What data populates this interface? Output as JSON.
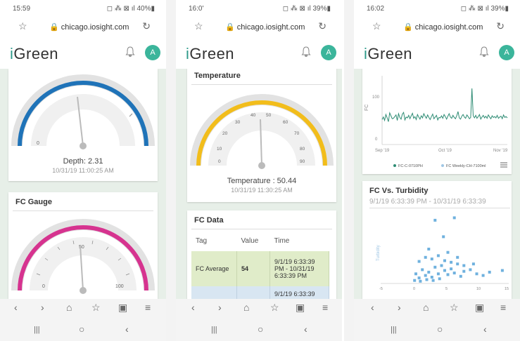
{
  "phones": [
    {
      "status": {
        "time": "15:59",
        "icons": "◻ ⁂ ⊠ ıl 40%▮"
      },
      "url": "chicago.iosight.com",
      "logo": {
        "i": "i",
        "rest": "Green"
      },
      "avatar": "A",
      "depth_card": {
        "value_label": "Depth: 2.31",
        "timestamp": "10/31/19 11:00:25 AM"
      },
      "fc_card": {
        "title": "FC Gauge"
      }
    },
    {
      "status": {
        "time": "16:0'",
        "icons": "◻ ⁂ ⊠ ıl 39%▮"
      },
      "url": "chicago.iosight.com",
      "logo": {
        "i": "i",
        "rest": "Green"
      },
      "avatar": "A",
      "temp_card": {
        "title": "Temperature",
        "value_label": "Temperature : 50.44",
        "timestamp": "10/31/19 11:30:25 AM"
      },
      "fc_data": {
        "title": "FC Data",
        "headers": [
          "Tag",
          "Value",
          "Time"
        ],
        "rows": [
          {
            "tag": "FC Average",
            "value": "54",
            "time": "9/1/19 6:33:39 PM - 10/31/19 6:33:39 PM"
          },
          {
            "tag": "",
            "value": "",
            "time": "9/1/19 6:33:39"
          }
        ]
      }
    },
    {
      "status": {
        "time": "16:02",
        "icons": "◻ ⁂ ⊠ ıl 39%▮"
      },
      "url": "chicago.iosight.com",
      "logo": {
        "i": "i",
        "rest": "Green"
      },
      "avatar": "A",
      "line_chart": {
        "ylabel": "FC",
        "yticks": [
          "100",
          "0"
        ],
        "xticks": [
          "Sep '19",
          "Oct '19",
          "Nov '19"
        ],
        "legend": [
          "FC-C-0710PH",
          "FC Weekly-CH-7100ml"
        ]
      },
      "scatter_card": {
        "title": "FC Vs. Turbidity",
        "subtitle": "9/1/19 6:33:39 PM - 10/31/19 6:33:39",
        "ylabel": "Turbidity",
        "xticks": [
          "0",
          "5",
          "10",
          "15"
        ]
      }
    }
  ],
  "nav": {
    "back": "‹",
    "forward": "›",
    "home": "⌂",
    "bookmark": "☆",
    "tabs": "▣",
    "menu": "≡"
  },
  "sys": {
    "recent": "|||",
    "home": "○",
    "back": "‹"
  },
  "colors": {
    "accent": "#2e9a8a",
    "depth_arc": "#1f73b8",
    "fc_arc": "#d6338f",
    "temp_arc": "#f2bd1b",
    "line": "#2e8c74",
    "scatter": "#6fb1de"
  },
  "gauges": {
    "depth_value": 2.31,
    "temperature_value": 50.44,
    "temperature_max": 60
  },
  "chart_data": [
    {
      "type": "line",
      "title": "",
      "xlabel": "",
      "ylabel": "FC",
      "x_range": [
        "Sep '19",
        "Nov '19"
      ],
      "ylim": [
        0,
        100
      ],
      "series": [
        {
          "name": "FC-C-0710PH",
          "values": [
            46,
            52,
            44,
            58,
            50,
            41,
            62,
            55,
            48,
            49,
            53,
            57,
            44,
            60,
            51,
            47,
            59,
            63,
            45,
            52,
            50,
            56,
            48,
            55,
            61,
            49,
            53,
            46,
            58,
            52,
            47,
            55,
            50,
            60,
            54,
            49,
            57,
            51,
            46,
            53,
            59,
            48,
            52,
            56,
            45,
            51,
            50,
            55,
            49,
            58,
            53,
            47,
            54,
            60,
            52,
            49,
            56,
            51,
            48,
            55,
            65,
            50,
            47,
            54,
            58,
            52,
            49,
            57,
            53,
            48,
            51,
            120,
            55,
            50,
            56,
            49,
            53,
            58,
            47,
            52,
            56,
            50,
            54,
            49,
            57,
            52,
            48,
            55,
            51,
            53,
            50,
            56,
            49,
            52,
            54,
            48,
            57,
            51,
            53,
            50
          ]
        },
        {
          "name": "FC Weekly-CH-7100ml",
          "values": []
        }
      ]
    },
    {
      "type": "scatter",
      "title": "FC Vs. Turbidity",
      "xlabel": "",
      "ylabel": "Turbidity",
      "xlim": [
        -5,
        15
      ],
      "points": [
        [
          0.5,
          1
        ],
        [
          1,
          0.5
        ],
        [
          1.5,
          1.5
        ],
        [
          2,
          0.8
        ],
        [
          2.5,
          1.2
        ],
        [
          3,
          0.6
        ],
        [
          3.5,
          1.8
        ],
        [
          4,
          1
        ],
        [
          4.5,
          2
        ],
        [
          5,
          1.4
        ],
        [
          5.5,
          0.9
        ],
        [
          6,
          1.6
        ],
        [
          6.5,
          1.1
        ],
        [
          7,
          2.2
        ],
        [
          7.5,
          0.7
        ],
        [
          8,
          1.3
        ],
        [
          1,
          2.5
        ],
        [
          2,
          3
        ],
        [
          3,
          2.8
        ],
        [
          4,
          3.2
        ],
        [
          5,
          2.6
        ],
        [
          6,
          2.4
        ],
        [
          7,
          3
        ],
        [
          8,
          2
        ],
        [
          9,
          1.5
        ],
        [
          10,
          1
        ],
        [
          12,
          1.2
        ],
        [
          14,
          1.4
        ],
        [
          4.8,
          5.5
        ],
        [
          3.5,
          7.5
        ],
        [
          6.5,
          7.8
        ],
        [
          2.5,
          4
        ],
        [
          5.5,
          3.6
        ],
        [
          0.3,
          0.2
        ],
        [
          1.2,
          0.1
        ],
        [
          2.2,
          0.3
        ],
        [
          3.2,
          0.2
        ],
        [
          4.2,
          0.4
        ],
        [
          9.5,
          2.2
        ],
        [
          11,
          0.8
        ]
      ]
    }
  ]
}
